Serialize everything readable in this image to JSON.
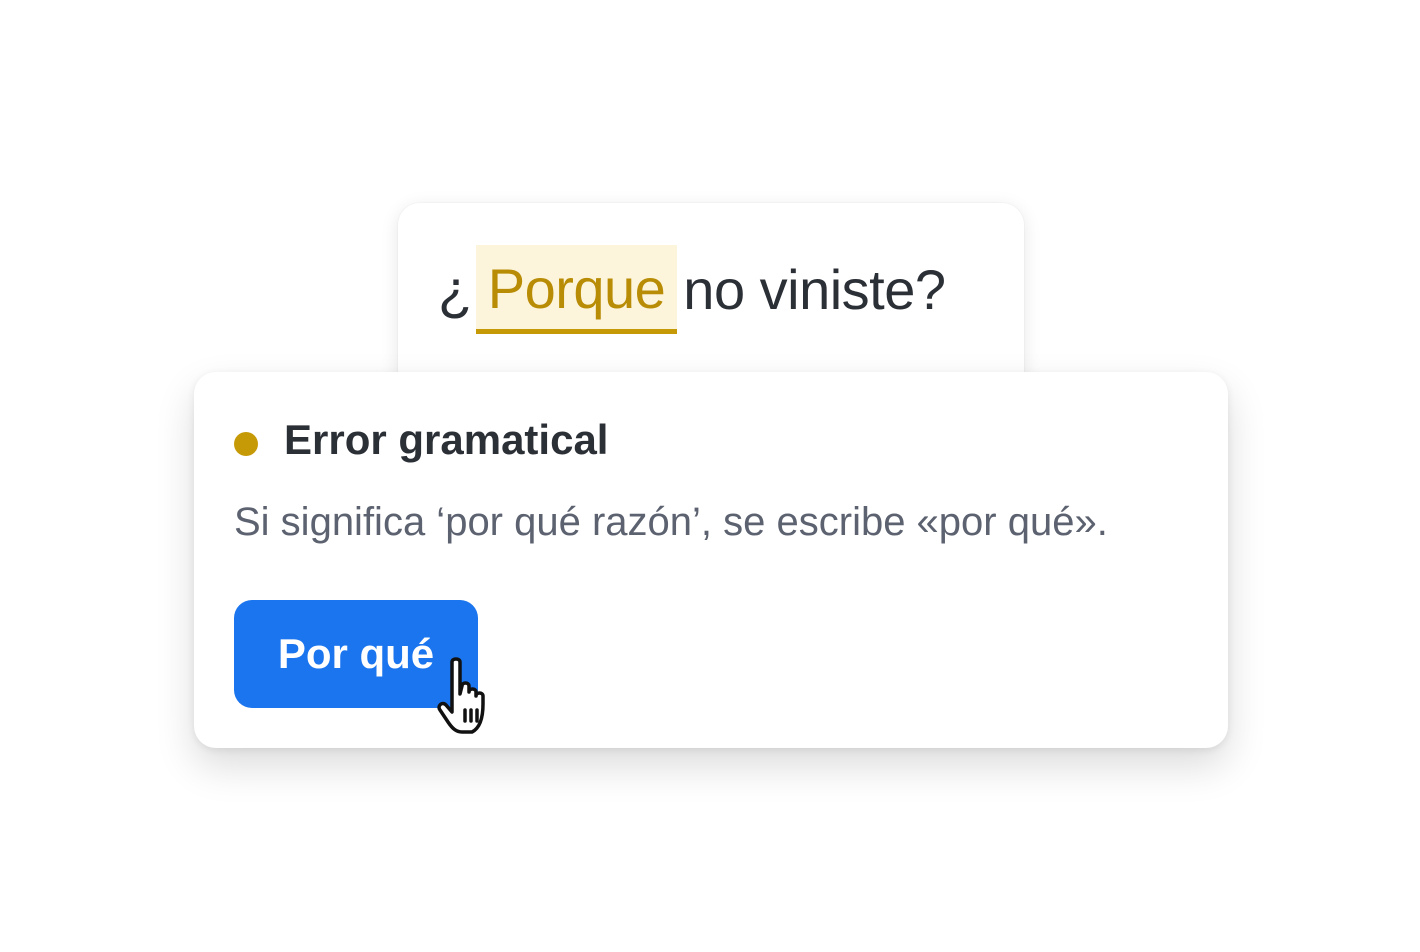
{
  "sentence": {
    "prefix": "¿",
    "flagged_word": "Porque",
    "rest": "no viniste?"
  },
  "suggestion": {
    "title": "Error gramatical",
    "message": "Si significa ‘por qué razón’, se escribe «por qué».",
    "fix_label": "Por qué",
    "indicator_color": "#c69a07"
  },
  "colors": {
    "accent": "#1a75ee",
    "warning": "#c69a07",
    "highlight_bg": "#fdf4dc"
  },
  "icons": {
    "status": "status-dot-icon",
    "pointer": "hand-pointer-icon"
  }
}
